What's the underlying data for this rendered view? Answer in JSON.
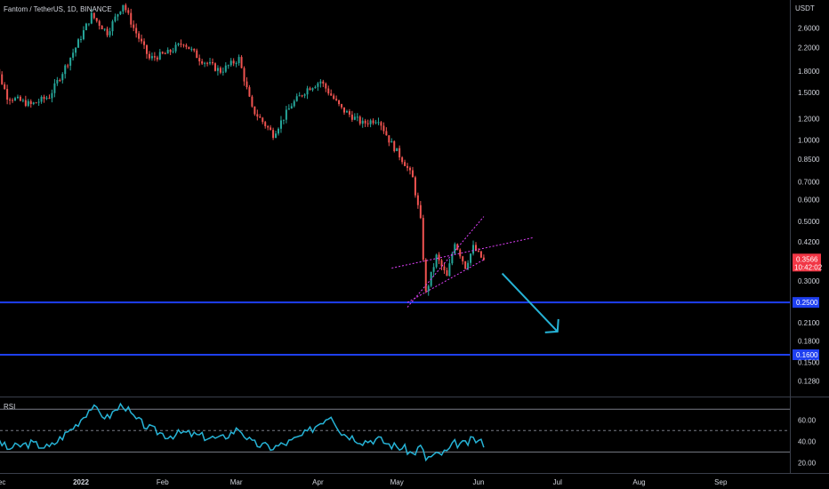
{
  "chart_data": {
    "type": "candlestick",
    "title": "Fantom / TetherUS, 1D, BINANCE",
    "y_axis_unit": "USDT",
    "y_scale": "log",
    "ylim": [
      0.112,
      3.3
    ],
    "x_ticks": [
      "Dec",
      "2022",
      "Feb",
      "Mar",
      "Apr",
      "May",
      "Jun",
      "Jul",
      "Aug",
      "Sep"
    ],
    "x_tick_dates": [
      "2021-12-01",
      "2022-01-01",
      "2022-02-01",
      "2022-03-01",
      "2022-04-01",
      "2022-05-01",
      "2022-06-01",
      "2022-07-01",
      "2022-08-01",
      "2022-09-01"
    ],
    "y_ticks": [
      2.6,
      2.2,
      1.8,
      1.5,
      1.2,
      1.0,
      0.85,
      0.7,
      0.6,
      0.5,
      0.42,
      0.3,
      0.21,
      0.18,
      0.15,
      0.128
    ],
    "y_tick_labels": [
      "2.6000",
      "2.2000",
      "1.8000",
      "1.5000",
      "1.2000",
      "1.0000",
      "0.8500",
      "0.7000",
      "0.6000",
      "0.5000",
      "0.4200",
      "0.3000",
      "0.2100",
      "0.1800",
      "0.1500",
      "0.1280"
    ],
    "last_price": {
      "value": 0.3566,
      "label": "0.3566",
      "countdown": "10:42:02",
      "color": "#f23645"
    },
    "horizontal_levels": [
      {
        "value": 0.25,
        "label": "0.2500",
        "color": "#1e3ff0"
      },
      {
        "value": 0.16,
        "label": "0.1600",
        "color": "#1e3ff0"
      }
    ],
    "channel_lines": [
      {
        "start": [
          "2022-04-29",
          0.335
        ],
        "end": [
          "2022-06-22",
          0.435
        ],
        "color": "#e040fb"
      },
      {
        "start": [
          "2022-05-05",
          0.24
        ],
        "end": [
          "2022-06-03",
          0.52
        ],
        "color": "#e040fb",
        "note": "upper line of pink channel"
      },
      {
        "start": [
          "2022-05-05",
          0.25
        ],
        "end": [
          "2022-06-03",
          0.36
        ],
        "color": "#e040fb",
        "note": "lower line of pink channel"
      }
    ],
    "arrow": {
      "start": [
        "2022-06-10",
        0.32
      ],
      "end": [
        "2022-07-01",
        0.195
      ],
      "color": "#26b3d6"
    },
    "candles_anchor_points": [
      [
        "2021-11-27",
        2.2
      ],
      [
        "2021-12-04",
        1.45
      ],
      [
        "2021-12-13",
        1.35
      ],
      [
        "2021-12-20",
        1.45
      ],
      [
        "2021-12-30",
        2.2
      ],
      [
        "2022-01-05",
        2.9
      ],
      [
        "2022-01-11",
        2.5
      ],
      [
        "2022-01-17",
        3.2
      ],
      [
        "2022-01-21",
        2.6
      ],
      [
        "2022-01-27",
        2.0
      ],
      [
        "2022-02-03",
        2.1
      ],
      [
        "2022-02-09",
        2.3
      ],
      [
        "2022-02-15",
        2.0
      ],
      [
        "2022-02-23",
        1.8
      ],
      [
        "2022-03-02",
        2.0
      ],
      [
        "2022-03-07",
        1.3
      ],
      [
        "2022-03-15",
        1.05
      ],
      [
        "2022-03-22",
        1.35
      ],
      [
        "2022-03-28",
        1.55
      ],
      [
        "2022-04-02",
        1.65
      ],
      [
        "2022-04-10",
        1.3
      ],
      [
        "2022-04-18",
        1.15
      ],
      [
        "2022-04-24",
        1.2
      ],
      [
        "2022-04-28",
        1.0
      ],
      [
        "2022-05-04",
        0.82
      ],
      [
        "2022-05-07",
        0.72
      ],
      [
        "2022-05-10",
        0.5
      ],
      [
        "2022-05-12",
        0.27
      ],
      [
        "2022-05-16",
        0.37
      ],
      [
        "2022-05-20",
        0.31
      ],
      [
        "2022-05-23",
        0.42
      ],
      [
        "2022-05-27",
        0.34
      ],
      [
        "2022-05-30",
        0.4
      ],
      [
        "2022-06-03",
        0.3566
      ]
    ],
    "rsi": {
      "label": "RSI",
      "levels": [
        70,
        50,
        30
      ],
      "y_ticks": [
        60,
        40,
        20
      ],
      "y_tick_labels": [
        "60.00",
        "40.00",
        "20.00"
      ],
      "ylim": [
        12,
        81
      ],
      "color": "#26b3d6",
      "anchor_points": [
        [
          "2021-11-27",
          50
        ],
        [
          "2021-12-04",
          33
        ],
        [
          "2021-12-13",
          38
        ],
        [
          "2021-12-20",
          34
        ],
        [
          "2021-12-30",
          55
        ],
        [
          "2022-01-05",
          72
        ],
        [
          "2022-01-11",
          62
        ],
        [
          "2022-01-17",
          75
        ],
        [
          "2022-01-21",
          62
        ],
        [
          "2022-01-27",
          52
        ],
        [
          "2022-02-03",
          45
        ],
        [
          "2022-02-09",
          48
        ],
        [
          "2022-02-15",
          45
        ],
        [
          "2022-02-23",
          42
        ],
        [
          "2022-03-02",
          52
        ],
        [
          "2022-03-07",
          38
        ],
        [
          "2022-03-15",
          34
        ],
        [
          "2022-03-22",
          40
        ],
        [
          "2022-03-28",
          48
        ],
        [
          "2022-04-02",
          58
        ],
        [
          "2022-04-06",
          65
        ],
        [
          "2022-04-10",
          48
        ],
        [
          "2022-04-18",
          40
        ],
        [
          "2022-04-24",
          42
        ],
        [
          "2022-04-28",
          37
        ],
        [
          "2022-05-04",
          33
        ],
        [
          "2022-05-07",
          28
        ],
        [
          "2022-05-10",
          35
        ],
        [
          "2022-05-12",
          24
        ],
        [
          "2022-05-16",
          27
        ],
        [
          "2022-05-20",
          30
        ],
        [
          "2022-05-23",
          38
        ],
        [
          "2022-05-27",
          37
        ],
        [
          "2022-05-30",
          42
        ],
        [
          "2022-06-03",
          38
        ]
      ]
    }
  },
  "colors": {
    "up": "#26a69a",
    "down": "#ef5350",
    "axis_text": "#d1d4dc",
    "grid_border": "#3a3e4a"
  }
}
